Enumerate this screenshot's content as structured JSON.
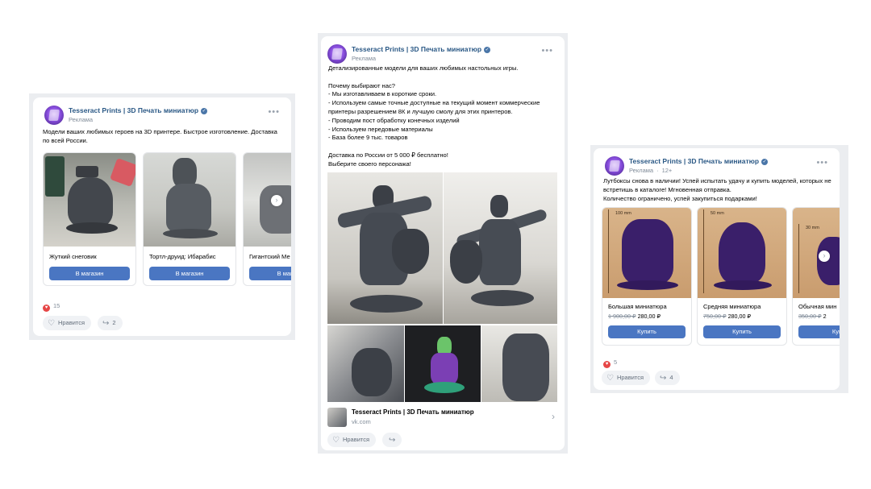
{
  "post_left": {
    "author": "Tesseract Prints | 3D Печать миниатюр",
    "subtitle": "Реклама",
    "text_lines": [
      "Модели ваших любимых героев на 3D принтере. Быстрое изготовление. Доставка",
      "по всей России."
    ],
    "products": [
      {
        "title": "Жуткий снеговик",
        "button": "В магазин"
      },
      {
        "title": "Тортл-друид: Ибарабис",
        "button": "В магазин"
      },
      {
        "title": "Гигантский Ме",
        "button": "В магази"
      }
    ],
    "likes_count": "15",
    "like_label": "Нравится",
    "shares_count": "2"
  },
  "post_center": {
    "author": "Tesseract Prints | 3D Печать миниатюр",
    "subtitle": "Реклама",
    "text_lines": [
      "Детализированные модели для ваших любимых настольных игры.",
      "",
      "Почему выбирают нас?",
      "- Мы изготавливаем в короткие сроки.",
      "- Используем самые точные доступные на текущий момент коммерческие",
      "принтеры разрешением 8К и лучшую смолу для этих принтеров.",
      "- Проводим пост обработку конечных изделий",
      "- Используем передовые материалы",
      "- База более 9 тыс. товаров",
      "",
      "Доставка по России от 5 000 ₽ бесплатно!",
      "Выберите своего персонажа!"
    ],
    "link_title": "Tesseract Prints | 3D Печать миниатюр",
    "link_domain": "vk.com",
    "like_label": "Нравится"
  },
  "post_right": {
    "author": "Tesseract Prints | 3D Печать миниатюр",
    "subtitle": "Реклама",
    "age_rating": "12+",
    "text_lines": [
      "Лутбоксы снова в наличии! Успей испытать удачу и купить моделей, которых не",
      "встретишь в каталоге! Мгновенная отправка.",
      "Количество ограничено, успей закупиться подарками!"
    ],
    "products": [
      {
        "size_label": "100 mm",
        "title": "Большая миниатюра",
        "old_price": "1 900,00 ₽",
        "price": "280,00 ₽",
        "button": "Купить"
      },
      {
        "size_label": "50 mm",
        "title": "Средняя миниатюра",
        "old_price": "750,00 ₽",
        "price": "280,00 ₽",
        "button": "Купить"
      },
      {
        "size_label": "30 mm",
        "title": "Обычная мин",
        "old_price": "350,00 ₽",
        "price": "2",
        "button": "Куп"
      }
    ],
    "likes_count": "5",
    "like_label": "Нравится",
    "shares_count": "4"
  },
  "colors": {
    "link_blue": "#2a5885",
    "button_blue": "#4a76c2",
    "heart_red": "#e64646",
    "frame_gray": "#ebedf0"
  }
}
